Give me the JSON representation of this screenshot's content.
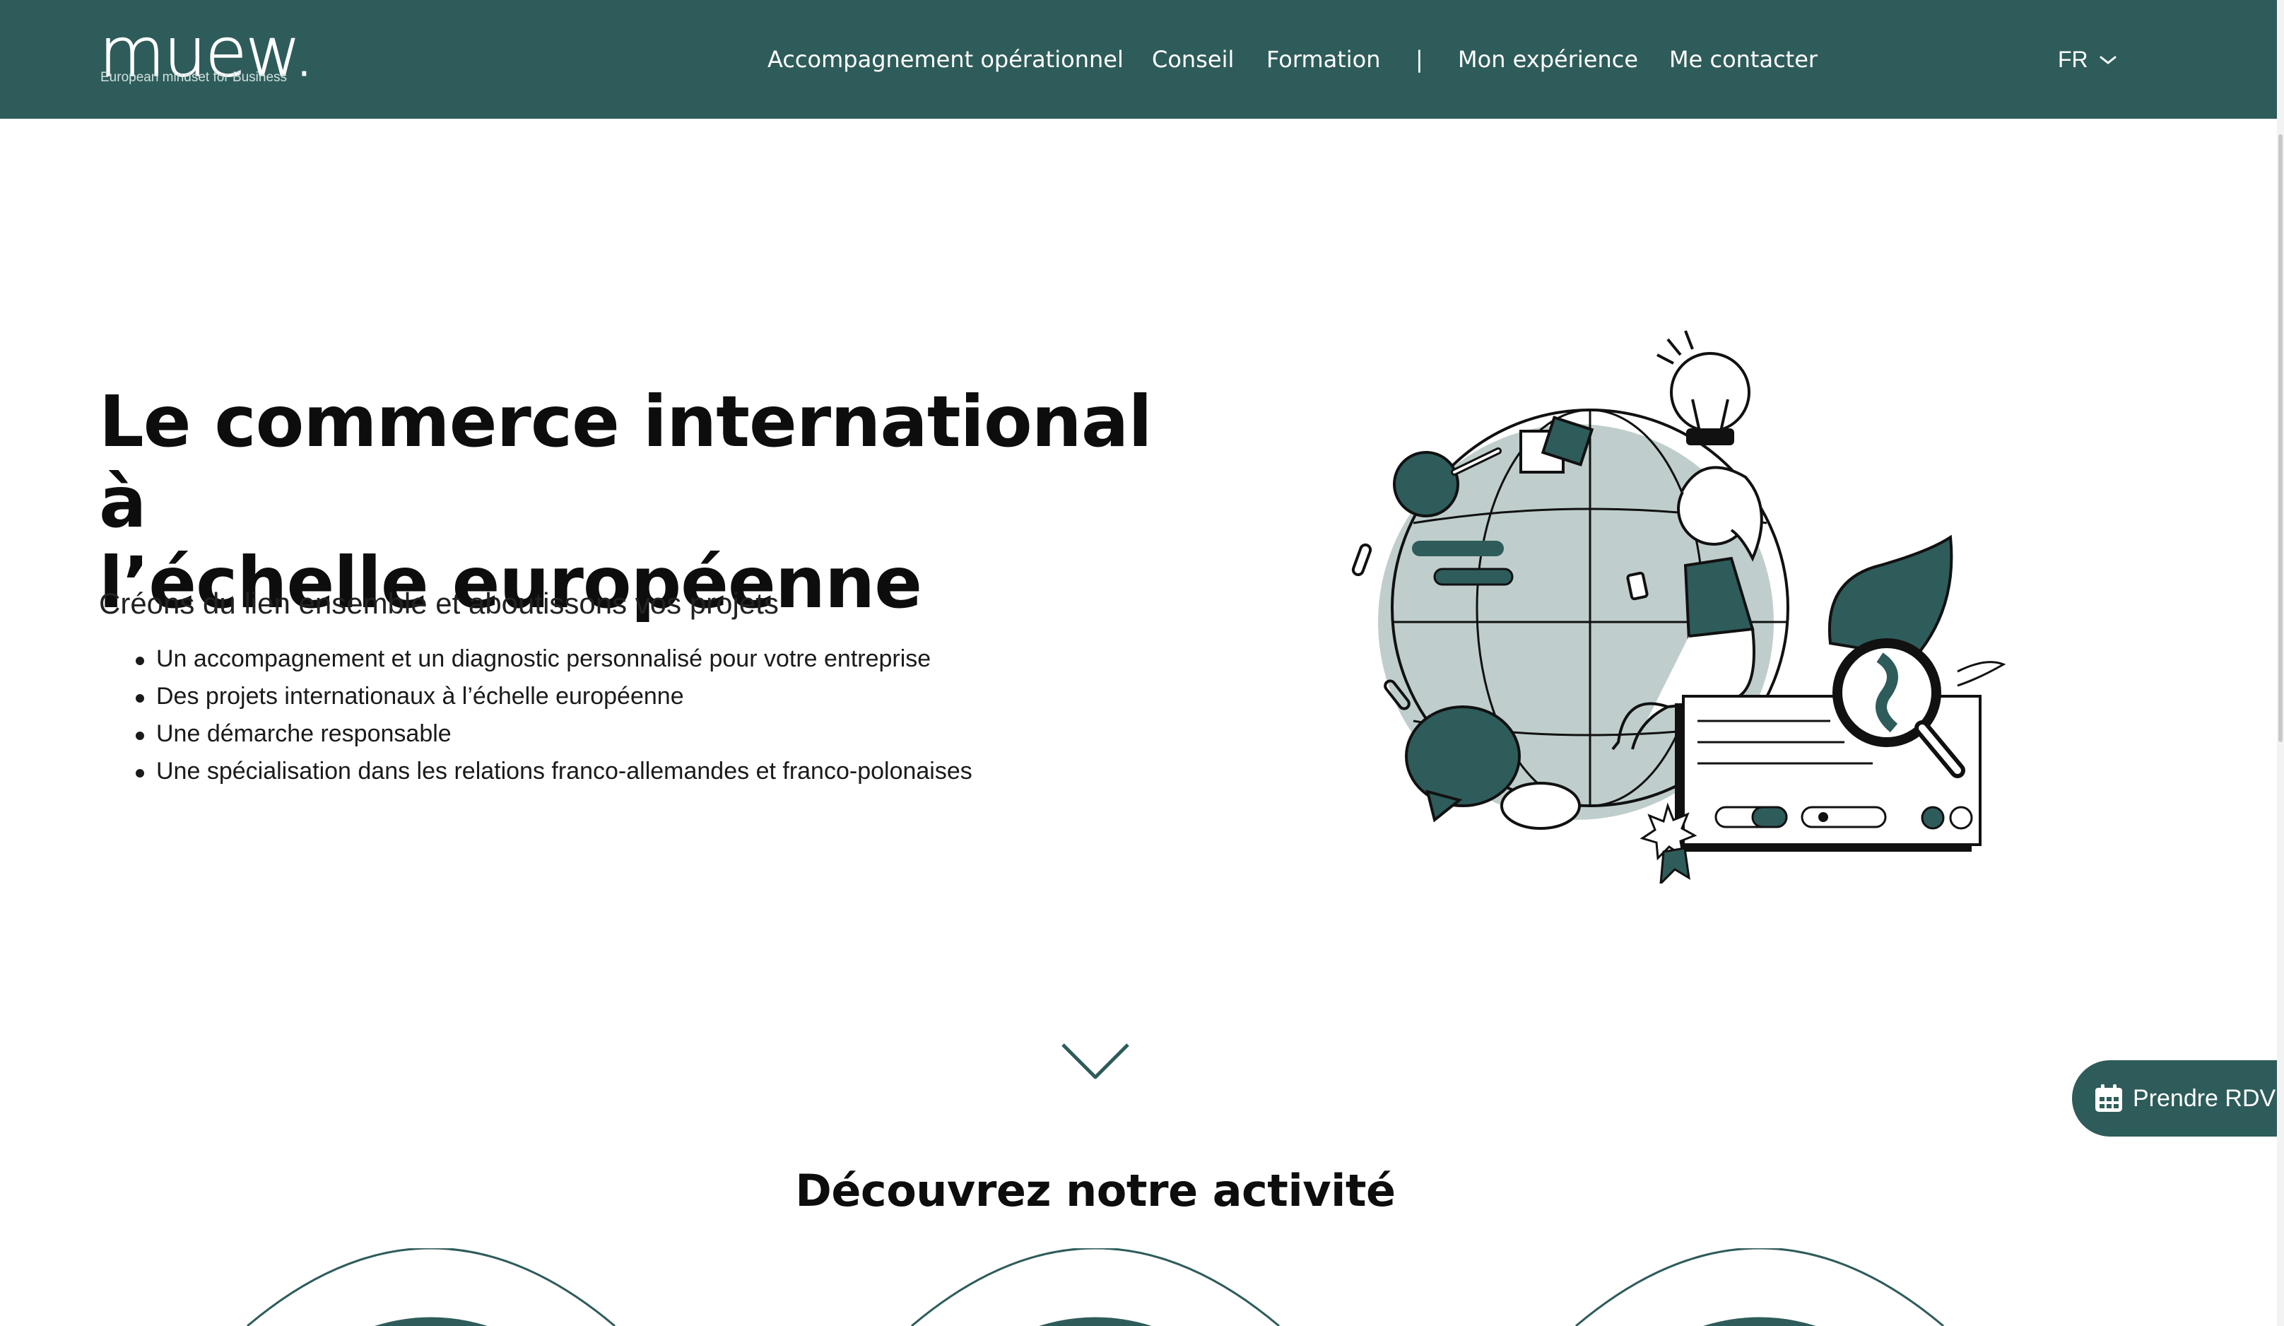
{
  "header": {
    "logo": {
      "wordmark": "muew.",
      "tagline": "European mindset for Business"
    },
    "nav": [
      {
        "label": "Accompagnement opérationnel"
      },
      {
        "label": "Conseil"
      },
      {
        "label": "Formation"
      },
      {
        "label": "|"
      },
      {
        "label": "Mon expérience"
      },
      {
        "label": "Me contacter"
      }
    ],
    "language": {
      "selected": "FR",
      "icon": "chevron-down-icon"
    }
  },
  "hero": {
    "title_line1": "Le commerce international à",
    "title_line2": "l’échelle européenne",
    "subtitle": "Créons du lien ensemble et aboutissons vos projets",
    "bullets": [
      "Un accompagnement et un diagnostic personnalisé pour votre entreprise",
      "Des projets internationaux à l’échelle européenne",
      "Une démarche responsable",
      "Une spécialisation dans les relations franco-allemandes et franco-polonaises"
    ]
  },
  "activity": {
    "title": "Découvrez notre activité"
  },
  "rdv": {
    "label": "Prendre RDV",
    "icon": "calendar-icon"
  },
  "colors": {
    "brand": "#2e5c5a",
    "globe": "#bfcecc",
    "text": "#111111"
  }
}
